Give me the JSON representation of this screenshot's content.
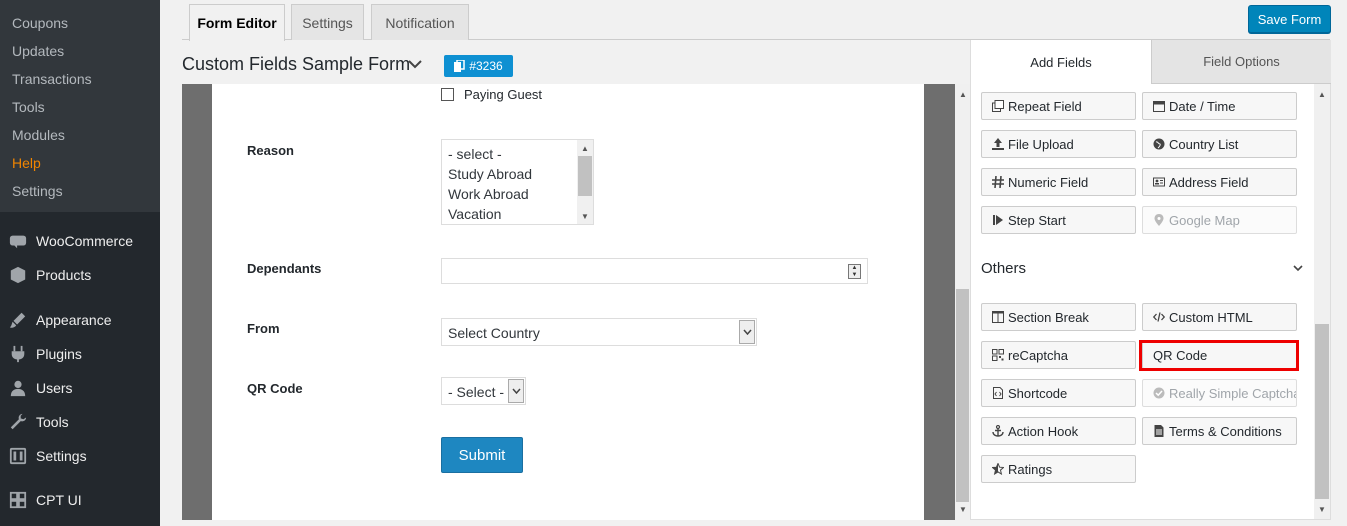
{
  "sidebar": {
    "submenu": [
      {
        "label": "Coupons",
        "active": false
      },
      {
        "label": "Updates",
        "active": false
      },
      {
        "label": "Transactions",
        "active": false
      },
      {
        "label": "Tools",
        "active": false
      },
      {
        "label": "Modules",
        "active": false
      },
      {
        "label": "Help",
        "active": true
      },
      {
        "label": "Settings",
        "active": false
      }
    ],
    "menu": [
      {
        "label": "WooCommerce",
        "icon": "woocommerce-icon"
      },
      {
        "label": "Products",
        "icon": "products-icon"
      },
      {
        "label": "Appearance",
        "icon": "appearance-icon"
      },
      {
        "label": "Plugins",
        "icon": "plugins-icon"
      },
      {
        "label": "Users",
        "icon": "users-icon"
      },
      {
        "label": "Tools",
        "icon": "tools-icon"
      },
      {
        "label": "Settings",
        "icon": "settings-icon"
      },
      {
        "label": "CPT UI",
        "icon": "cpt-ui-icon"
      }
    ]
  },
  "top_tabs": [
    {
      "label": "Form Editor",
      "active": true
    },
    {
      "label": "Settings",
      "active": false
    },
    {
      "label": "Notification",
      "active": false
    }
  ],
  "save_label": "Save Form",
  "form": {
    "title": "Custom Fields Sample Form",
    "id_badge": "#3236"
  },
  "editor": {
    "paying_guest": "Paying Guest",
    "reason": {
      "label": "Reason",
      "options": [
        "- select -",
        "Study Abroad",
        "Work Abroad",
        "Vacation"
      ]
    },
    "dependants": {
      "label": "Dependants",
      "value": ""
    },
    "from": {
      "label": "From",
      "value": "Select Country"
    },
    "qr_code": {
      "label": "QR Code",
      "value": "- Select -"
    },
    "submit_label": "Submit"
  },
  "panel": {
    "tabs": [
      {
        "label": "Add Fields",
        "active": true
      },
      {
        "label": "Field Options",
        "active": false
      }
    ],
    "general_fields": [
      {
        "label": "Repeat Field",
        "icon": "repeat-field-icon",
        "disabled": false
      },
      {
        "label": "Date / Time",
        "icon": "calendar-icon",
        "disabled": false
      },
      {
        "label": "File Upload",
        "icon": "upload-icon",
        "disabled": false
      },
      {
        "label": "Country List",
        "icon": "globe-icon",
        "disabled": false
      },
      {
        "label": "Numeric Field",
        "icon": "hash-icon",
        "disabled": false
      },
      {
        "label": "Address Field",
        "icon": "address-card-icon",
        "disabled": false
      },
      {
        "label": "Step Start",
        "icon": "step-forward-icon",
        "disabled": false
      },
      {
        "label": "Google Map",
        "icon": "map-marker-icon",
        "disabled": true
      }
    ],
    "others_title": "Others",
    "other_fields": [
      {
        "label": "Section Break",
        "icon": "columns-icon",
        "disabled": false
      },
      {
        "label": "Custom HTML",
        "icon": "code-icon",
        "disabled": false
      },
      {
        "label": "reCaptcha",
        "icon": "qrcode-icon",
        "disabled": false
      },
      {
        "label": "QR Code",
        "icon": "",
        "disabled": false
      },
      {
        "label": "Shortcode",
        "icon": "file-code-icon",
        "disabled": false
      },
      {
        "label": "Really Simple Captcha",
        "icon": "check-circle-icon",
        "disabled": true
      },
      {
        "label": "Action Hook",
        "icon": "anchor-icon",
        "disabled": false
      },
      {
        "label": "Terms & Conditions",
        "icon": "file-text-icon",
        "disabled": false
      },
      {
        "label": "Ratings",
        "icon": "star-half-icon",
        "disabled": false
      }
    ]
  },
  "colors": {
    "sidebar_bg": "#23282d",
    "submenu_bg": "#32373c",
    "active_submenu": "#f18500",
    "primary_button": "#0085ba",
    "highlight": "#e00000"
  }
}
